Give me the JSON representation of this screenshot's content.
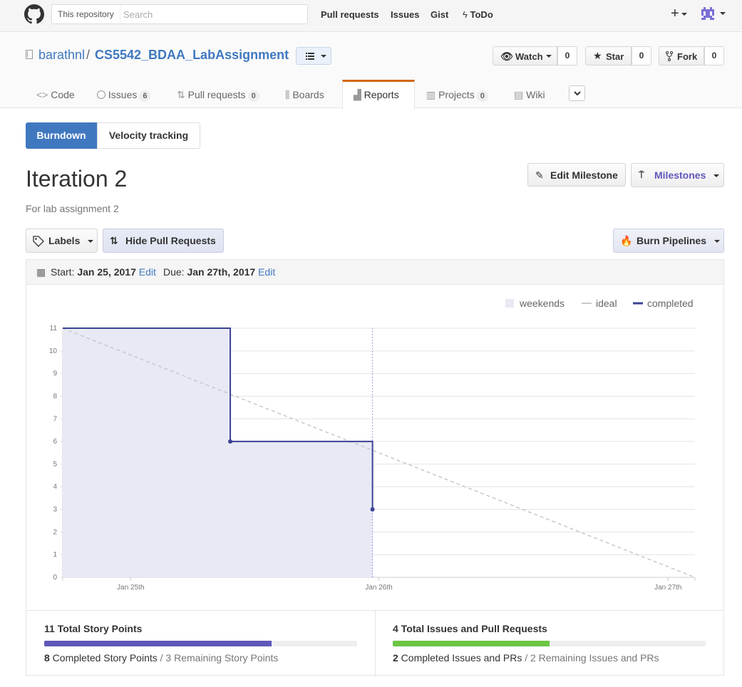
{
  "header": {
    "search_scope": "This repository",
    "search_placeholder": "Search",
    "nav": [
      "Pull requests",
      "Issues",
      "Gist",
      "ToDo"
    ]
  },
  "repo": {
    "owner": "barathnl",
    "separator": "/",
    "name": "CS5542_BDAA_LabAssignment",
    "watch": {
      "label": "Watch",
      "count": "0"
    },
    "star": {
      "label": "Star",
      "count": "0"
    },
    "fork": {
      "label": "Fork",
      "count": "0"
    },
    "tabs": [
      {
        "label": "Code",
        "count": ""
      },
      {
        "label": "Issues",
        "count": "6"
      },
      {
        "label": "Pull requests",
        "count": "0"
      },
      {
        "label": "Boards",
        "count": ""
      },
      {
        "label": "Reports",
        "count": ""
      },
      {
        "label": "Projects",
        "count": "0"
      },
      {
        "label": "Wiki",
        "count": ""
      }
    ],
    "active_tab": "Reports"
  },
  "report_tabs": {
    "burndown": "Burndown",
    "velocity": "Velocity tracking",
    "active": "Burndown"
  },
  "milestone": {
    "title": "Iteration 2",
    "description": "For lab assignment 2",
    "edit_button": "Edit Milestone",
    "milestones_button": "Milestones"
  },
  "toolbar": {
    "labels": "Labels",
    "hide_prs": "Hide Pull Requests",
    "burn_pipelines": "Burn Pipelines"
  },
  "dates": {
    "start_label": "Start:",
    "start": "Jan 25, 2017",
    "due_label": "Due:",
    "due": "Jan 27th, 2017",
    "edit": "Edit"
  },
  "chart_data": {
    "type": "line",
    "legend": [
      "weekends",
      "ideal",
      "completed"
    ],
    "legend_position": "top-right",
    "ylim": [
      0,
      11
    ],
    "yticks": [
      "0",
      "1",
      "2",
      "3",
      "4",
      "5",
      "6",
      "7",
      "8",
      "9",
      "10",
      "11"
    ],
    "xticks": [
      "Jan 25th",
      "Jan 26th",
      "Jan 27th"
    ],
    "xlim": [
      0,
      2
    ],
    "tick_positions": [
      0.215,
      1.0,
      1.915
    ],
    "ideal": {
      "x": [
        0,
        2
      ],
      "y": [
        11,
        0
      ]
    },
    "completed": {
      "x": [
        0,
        0.53,
        0.53,
        0.98,
        0.98
      ],
      "y": [
        11,
        11,
        6,
        6,
        3
      ]
    },
    "completed_points": [
      {
        "x": 0.53,
        "y": 6
      },
      {
        "x": 0.98,
        "y": 3
      }
    ],
    "today_x": 0.98,
    "grid": true,
    "colors": {
      "weekends": "#e8e9f4",
      "ideal": "#c8c8c8",
      "completed": "#3b4296",
      "today": "#9d94e8"
    }
  },
  "stats": {
    "points": {
      "total": "11 Total Story Points",
      "completed_num": "8",
      "completed_text": " Completed Story Points",
      "remaining": " / 3 Remaining Story Points",
      "fraction": 0.727,
      "color": "#6057bb"
    },
    "issues": {
      "total": "4 Total Issues and Pull Requests",
      "completed_num": "2",
      "completed_text": " Completed Issues and PRs",
      "remaining": " / 2 Remaining Issues and PRs",
      "fraction": 0.5,
      "color": "#6cc644"
    }
  }
}
